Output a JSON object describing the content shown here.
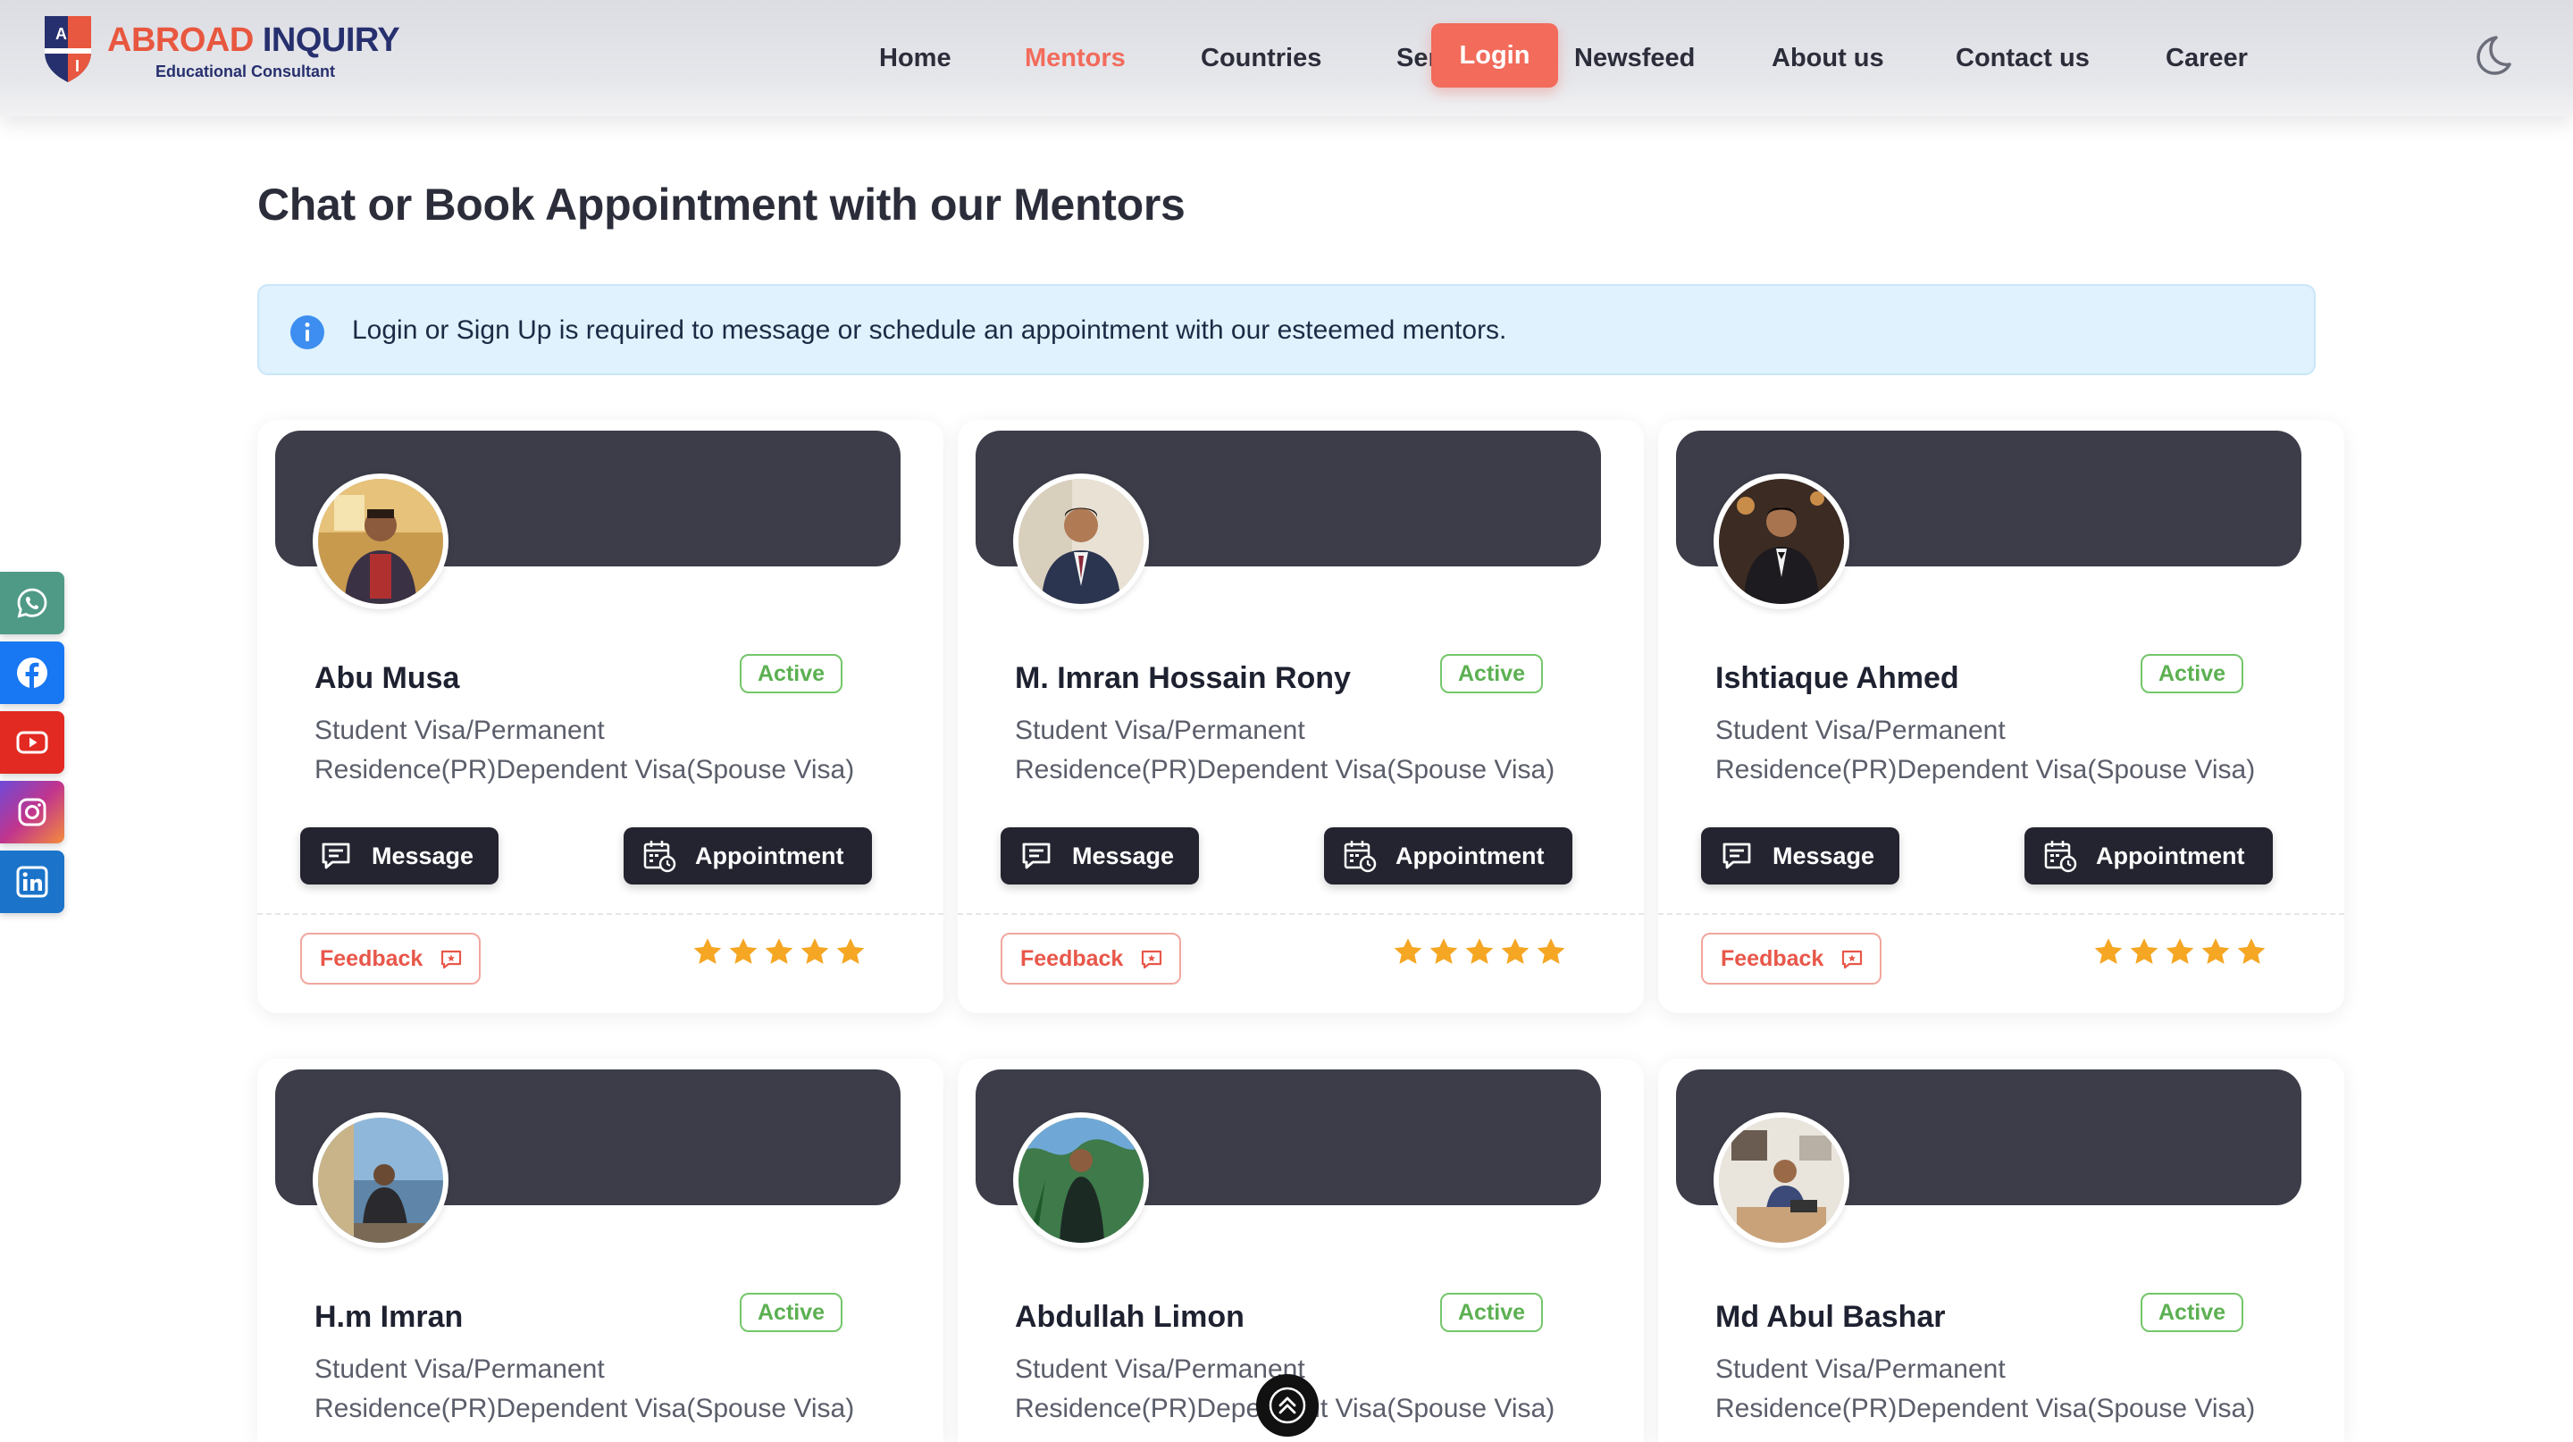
{
  "brand": {
    "name_part1": "ABROAD",
    "name_part2": "INQUIRY",
    "tagline": "Educational Consultant",
    "shield_letters": [
      "A",
      "I"
    ]
  },
  "nav": {
    "items": [
      {
        "label": "Home",
        "active": false
      },
      {
        "label": "Mentors",
        "active": true
      },
      {
        "label": "Countries",
        "active": false
      },
      {
        "label": "Services",
        "active": false
      },
      {
        "label": "Newsfeed",
        "active": false
      },
      {
        "label": "About us",
        "active": false
      },
      {
        "label": "Contact us",
        "active": false
      },
      {
        "label": "Career",
        "active": false
      }
    ],
    "login_label": "Login",
    "theme_toggle_icon": "moon-icon"
  },
  "page": {
    "title": "Chat or Book Appointment with our Mentors",
    "alert_text": "Login or Sign Up is required to message or schedule an appointment with our esteemed mentors.",
    "alert_icon": "info-icon"
  },
  "social": [
    {
      "name": "whatsapp",
      "icon": "whatsapp-icon",
      "color": "#4f9a86"
    },
    {
      "name": "facebook",
      "icon": "facebook-icon",
      "color": "#1877f2"
    },
    {
      "name": "youtube",
      "icon": "youtube-icon",
      "color": "#e22a22"
    },
    {
      "name": "instagram",
      "icon": "instagram-icon",
      "color": "#c1358d"
    },
    {
      "name": "linkedin",
      "icon": "linkedin-icon",
      "color": "#1b74c9"
    }
  ],
  "mentors": [
    {
      "name": "Abu Musa",
      "status": "Active",
      "description": "Student Visa/Permanent Residence(PR)Dependent Visa(Spouse Visa)",
      "rating": 5
    },
    {
      "name": "M. Imran Hossain Rony",
      "status": "Active",
      "description": "Student Visa/Permanent Residence(PR)Dependent Visa(Spouse Visa)",
      "rating": 5
    },
    {
      "name": "Ishtiaque Ahmed",
      "status": "Active",
      "description": "Student Visa/Permanent Residence(PR)Dependent Visa(Spouse Visa)",
      "rating": 5
    },
    {
      "name": "H.m Imran",
      "status": "Active",
      "description": "Student Visa/Permanent Residence(PR)Dependent Visa(Spouse Visa)",
      "rating": null
    },
    {
      "name": "Abdullah Limon",
      "status": "Active",
      "description": "Student Visa/Permanent Residence(PR)Dependent Visa(Spouse Visa)",
      "rating": null
    },
    {
      "name": "Md Abul Bashar",
      "status": "Active",
      "description": "Student Visa/Permanent Residence(PR)Dependent Visa(Spouse Visa)",
      "rating": null
    }
  ],
  "card_actions": {
    "message_label": "Message",
    "appointment_label": "Appointment",
    "feedback_label": "Feedback"
  },
  "colors": {
    "accent": "#f26b5b",
    "banner": "#3c3d49",
    "button_dark": "#23242f",
    "active_green": "#5cb052",
    "star": "#f5a623"
  }
}
